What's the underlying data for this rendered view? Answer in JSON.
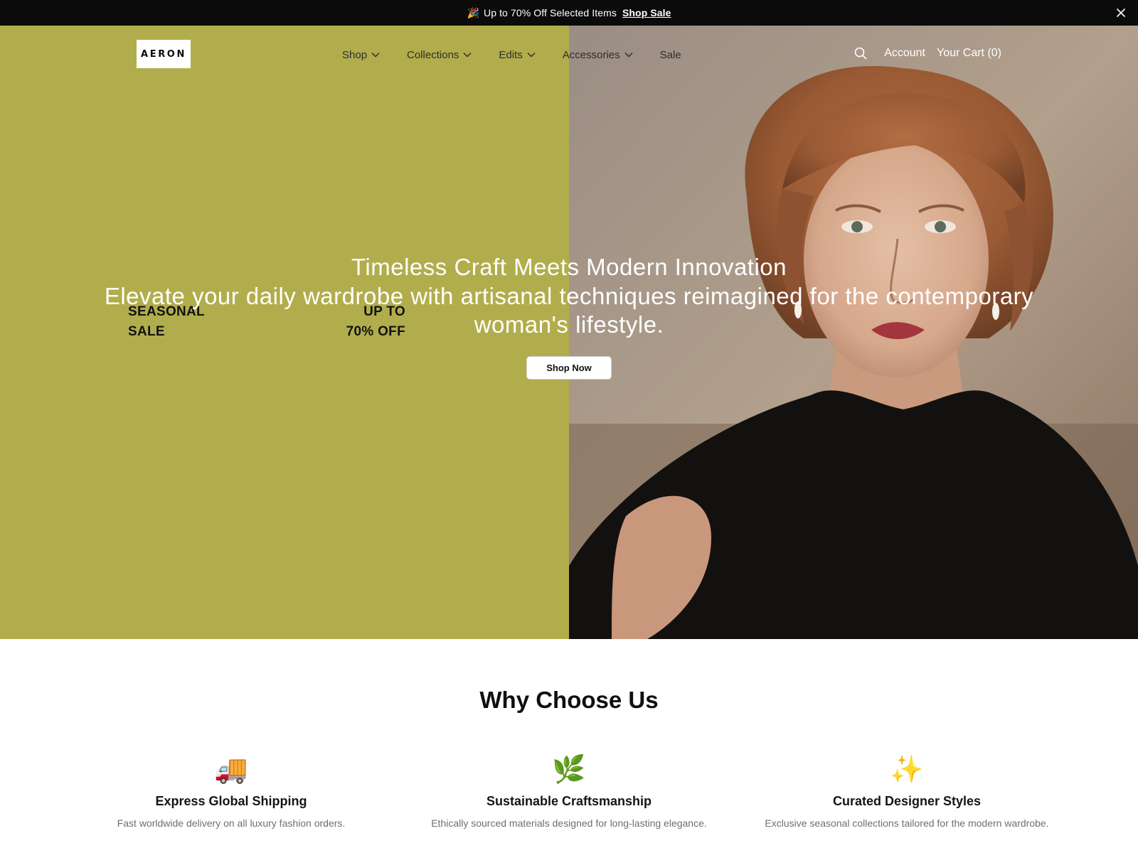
{
  "announcement": {
    "emoji": "🎉",
    "text": "Up to 70% Off Selected Items",
    "link_label": "Shop Sale"
  },
  "header": {
    "logo": "AERON",
    "nav": [
      {
        "label": "Shop",
        "has_dropdown": true
      },
      {
        "label": "Collections",
        "has_dropdown": true
      },
      {
        "label": "Edits",
        "has_dropdown": true
      },
      {
        "label": "Accessories",
        "has_dropdown": true
      },
      {
        "label": "Sale",
        "has_dropdown": false
      }
    ],
    "account_label": "Account",
    "cart_label": "Your Cart (0)"
  },
  "hero": {
    "poster_left": [
      "SEASONAL",
      "SALE"
    ],
    "poster_right": [
      "UP TO",
      "70% OFF"
    ],
    "title": "Timeless Craft Meets Modern Innovation",
    "subtitle": "Elevate your daily wardrobe with artisanal techniques reimagined for the contemporary woman's lifestyle.",
    "cta_label": "Shop Now",
    "left_panel_color": "#b2ad4c"
  },
  "why": {
    "title": "Why Choose Us",
    "features": [
      {
        "icon": "🚚",
        "icon_name": "delivery-truck-icon",
        "title": "Express Global Shipping",
        "desc": "Fast worldwide delivery on all luxury fashion orders."
      },
      {
        "icon": "🌿",
        "icon_name": "leaf-icon",
        "title": "Sustainable Craftsmanship",
        "desc": "Ethically sourced materials designed for long-lasting elegance."
      },
      {
        "icon": "✨",
        "icon_name": "sparkles-icon",
        "title": "Curated Designer Styles",
        "desc": "Exclusive seasonal collections tailored for the modern wardrobe."
      }
    ]
  }
}
